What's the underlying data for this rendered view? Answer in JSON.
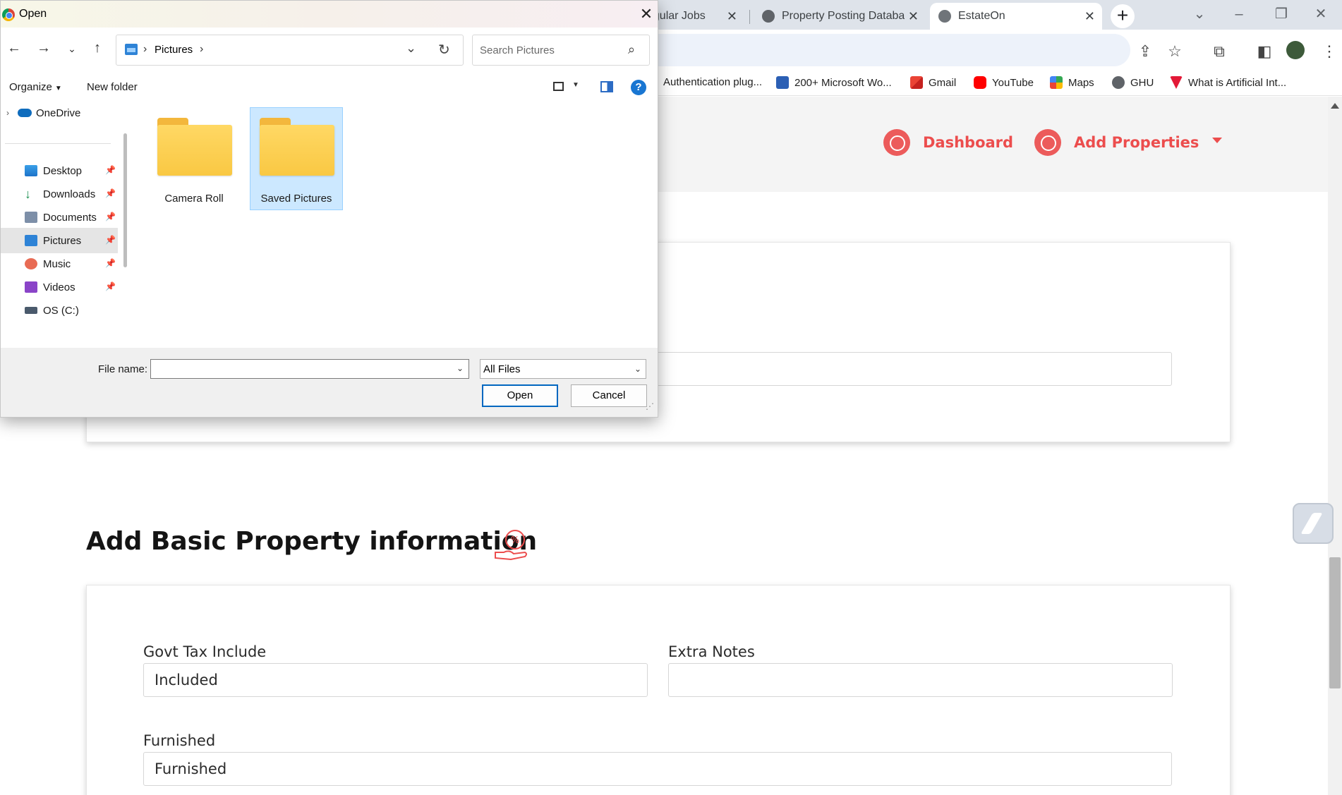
{
  "browser": {
    "tabs": [
      {
        "title": "ngular Jobs",
        "active": false
      },
      {
        "title": "Property Posting Databa",
        "active": false
      },
      {
        "title": "EstateOn",
        "active": true
      }
    ],
    "bookmarks": [
      {
        "label": "Authentication plug...",
        "icon": "puzzle-icon"
      },
      {
        "label": "200+ Microsoft Wo...",
        "icon": "word-icon"
      },
      {
        "label": "Gmail",
        "icon": "gmail-icon"
      },
      {
        "label": "YouTube",
        "icon": "youtube-icon"
      },
      {
        "label": "Maps",
        "icon": "maps-icon"
      },
      {
        "label": "GHU",
        "icon": "globe-icon"
      },
      {
        "label": "What is Artificial Int...",
        "icon": "tesla-icon"
      }
    ]
  },
  "navbar": {
    "links": [
      {
        "label": "Dashboard"
      },
      {
        "label": "Add Properties"
      }
    ]
  },
  "section": {
    "title": "Add Basic Property information"
  },
  "form": {
    "govt_tax_label": "Govt Tax Include",
    "govt_tax_value": "Included",
    "extra_notes_label": "Extra Notes",
    "extra_notes_value": "",
    "furnished_label": "Furnished",
    "furnished_value": "Furnished"
  },
  "dialog": {
    "title": "Open",
    "path": "Pictures",
    "search_placeholder": "Search Pictures",
    "organize_label": "Organize",
    "new_folder_label": "New folder",
    "nav_items": [
      {
        "label": "OneDrive"
      },
      {
        "label": "Desktop",
        "pinned": true
      },
      {
        "label": "Downloads",
        "pinned": true
      },
      {
        "label": "Documents",
        "pinned": true
      },
      {
        "label": "Pictures",
        "pinned": true,
        "selected": true
      },
      {
        "label": "Music",
        "pinned": true
      },
      {
        "label": "Videos",
        "pinned": true
      },
      {
        "label": "OS (C:)"
      }
    ],
    "folders": [
      {
        "label": "Camera Roll",
        "selected": false
      },
      {
        "label": "Saved Pictures",
        "selected": true
      }
    ],
    "file_name_label": "File name:",
    "file_name_value": "",
    "filter_value": "All Files",
    "open_label": "Open",
    "cancel_label": "Cancel"
  },
  "colors": {
    "accent": "#ec4d4d",
    "dialog_selection": "#cce8ff",
    "folder_yellow": "#ffd864"
  }
}
